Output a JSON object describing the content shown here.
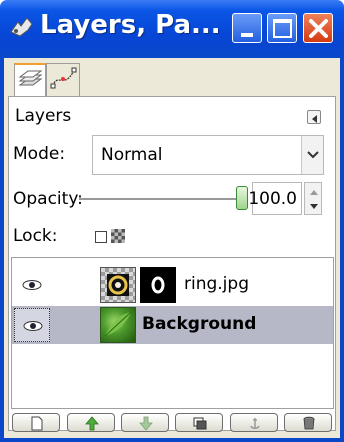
{
  "window": {
    "title": "Layers, Pa..."
  },
  "panel": {
    "title": "Layers",
    "mode_label": "Mode:",
    "mode_value": "Normal",
    "opacity_label": "Opacity:",
    "opacity_value": "100.0",
    "opacity_fraction": 1.0,
    "lock_label": "Lock:"
  },
  "layers": [
    {
      "name": "ring.jpg",
      "visible": true,
      "selected": false
    },
    {
      "name": "Background",
      "visible": true,
      "selected": true
    }
  ],
  "toolbar": [
    {
      "icon": "new-layer-icon"
    },
    {
      "icon": "raise-layer-icon"
    },
    {
      "icon": "lower-layer-icon"
    },
    {
      "icon": "duplicate-layer-icon"
    },
    {
      "icon": "anchor-layer-icon"
    },
    {
      "icon": "delete-layer-icon"
    }
  ],
  "colors": {
    "titlebar": "#0a56e6",
    "close_button": "#d43a12",
    "selected_row": "#b6b8c8"
  }
}
